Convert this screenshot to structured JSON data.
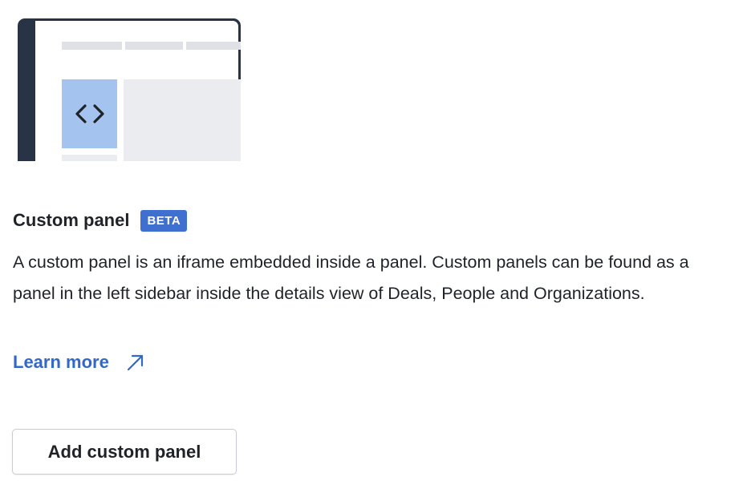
{
  "illustration": {
    "code_icon": "code-brackets-icon"
  },
  "panel": {
    "title": "Custom panel",
    "badge": "BETA",
    "description": "A custom panel is an iframe embedded inside a panel. Custom panels can be found as a panel in the left sidebar inside the details view of Deals, People and Organizations.",
    "learn_more_label": "Learn more",
    "learn_more_icon": "external-link-arrow-icon",
    "add_button_label": "Add custom panel"
  },
  "colors": {
    "accent": "#3268c7",
    "badge_bg": "#3f6fcf",
    "frame_dark": "#283345",
    "code_block": "#a5c3ef"
  }
}
